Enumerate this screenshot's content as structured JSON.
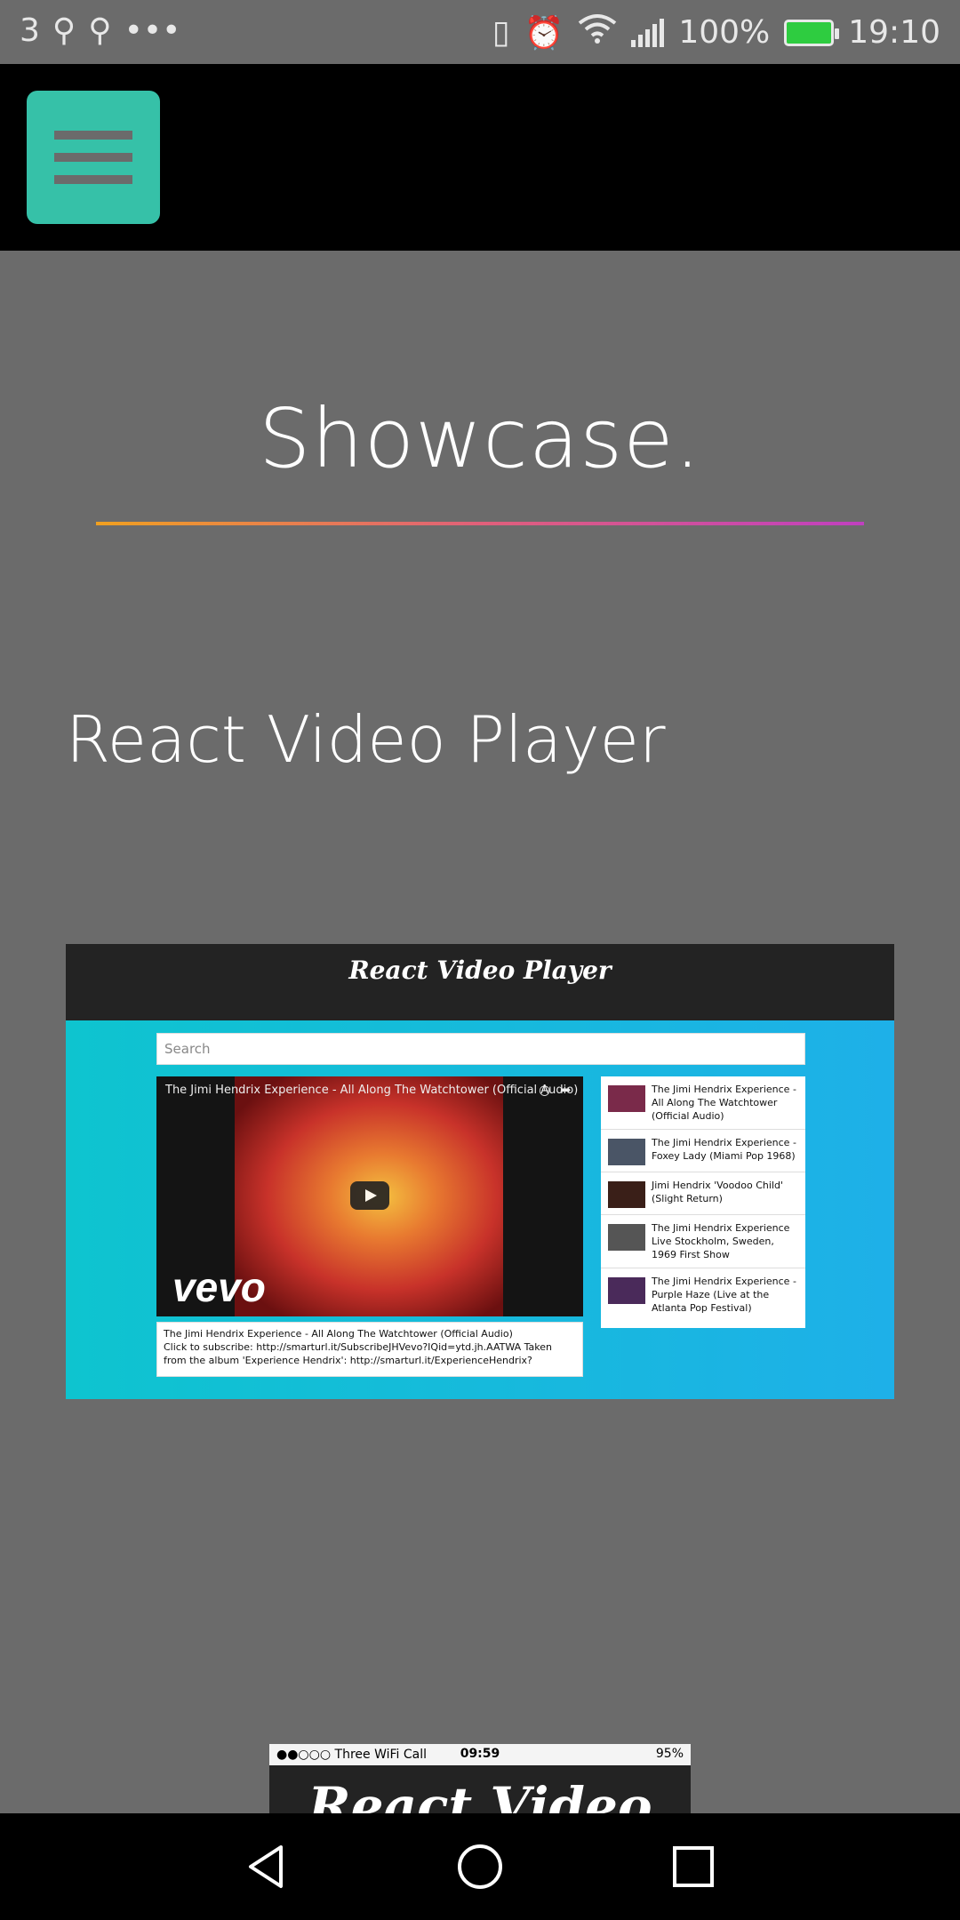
{
  "status_bar": {
    "notification_count": "3",
    "dots": "•••",
    "battery_percent": "100%",
    "time": "19:10"
  },
  "page": {
    "title": "Showcase.",
    "project_title": "React Video Player"
  },
  "embed": {
    "header": "React Video Player",
    "search_placeholder": "Search",
    "video_title": "The Jimi Hendrix Experience - All Along The Watchtower (Official Audio)",
    "video_brand": "vevo",
    "description_title": "The Jimi Hendrix Experience - All Along The Watchtower (Official Audio)",
    "description_body": "Click to subscribe: http://smarturl.it/SubscribeJHVevo?IQid=ytd.jh.AATWA Taken from the album 'Experience Hendrix': http://smarturl.it/ExperienceHendrix?",
    "list": [
      {
        "title": "The Jimi Hendrix Experience - All Along The Watchtower (Official Audio)"
      },
      {
        "title": "The Jimi Hendrix Experience - Foxey Lady (Miami Pop 1968)"
      },
      {
        "title": "Jimi Hendrix 'Voodoo Child' (Slight Return)"
      },
      {
        "title": "The Jimi Hendrix Experience Live Stockholm, Sweden, 1969 First Show"
      },
      {
        "title": "The Jimi Hendrix Experience - Purple Haze (Live at the Atlanta Pop Festival)"
      }
    ]
  },
  "ios_preview": {
    "carrier": "●●○○○ Three WiFi Call",
    "time": "09:59",
    "battery": "95%",
    "heading": "React Video Player"
  },
  "colors": {
    "accent": "#36c1a8",
    "background": "#6b6b6b",
    "gradient_start": "#f0a020",
    "gradient_end": "#c040c0"
  }
}
